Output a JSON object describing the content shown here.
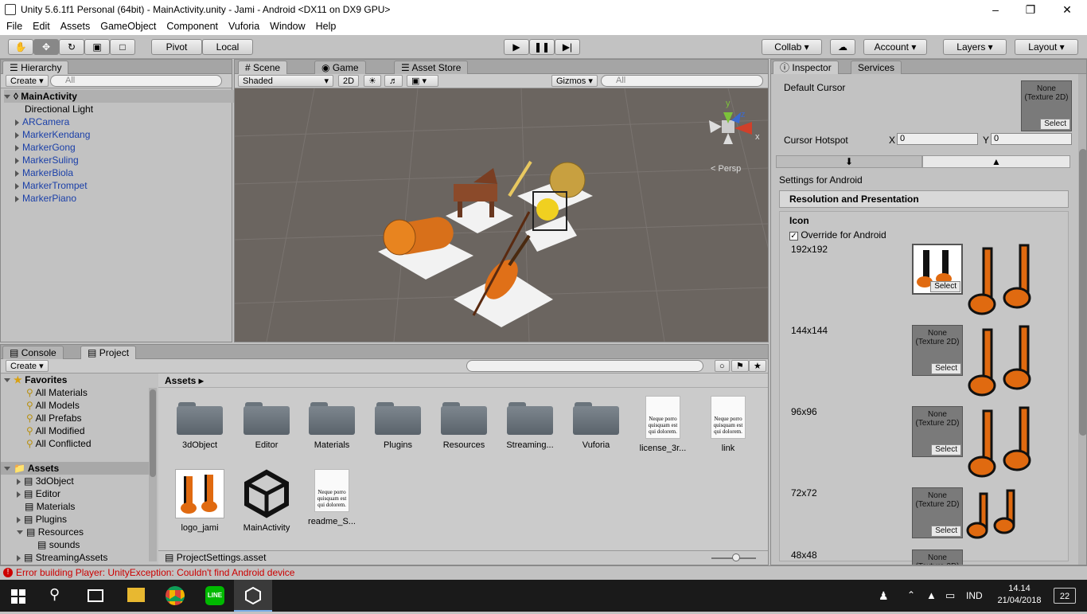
{
  "window": {
    "title": "Unity 5.6.1f1 Personal (64bit) - MainActivity.unity - Jami - Android <DX11 on DX9 GPU>"
  },
  "menu": [
    "File",
    "Edit",
    "Assets",
    "GameObject",
    "Component",
    "Vuforia",
    "Window",
    "Help"
  ],
  "toolbar": {
    "pivot": "Pivot",
    "local": "Local",
    "collab": "Collab ▾",
    "account": "Account",
    "layers": "Layers",
    "layout": "Layout"
  },
  "hierarchy": {
    "tab": "Hierarchy",
    "create": "Create ▾",
    "search_placeholder": "All",
    "scene": "MainActivity",
    "items": [
      "Directional Light",
      "ARCamera",
      "MarkerKendang",
      "MarkerGong",
      "MarkerSuling",
      "MarkerBiola",
      "MarkerTrompet",
      "MarkerPiano"
    ]
  },
  "scene": {
    "tabs": [
      "Scene",
      "Game",
      "Asset Store"
    ],
    "shaded": "Shaded",
    "mode2d": "2D",
    "gizmos": "Gizmos ▾",
    "search_placeholder": "All",
    "persp": "Persp",
    "gizmo_axes": {
      "y": "y",
      "z": "z",
      "x": "x"
    }
  },
  "project": {
    "tabs": [
      "Console",
      "Project"
    ],
    "create": "Create ▾",
    "breadcrumb": "Assets",
    "favorites_label": "Favorites",
    "favorites": [
      "All Materials",
      "All Models",
      "All Prefabs",
      "All Modified",
      "All Conflicted"
    ],
    "assets_label": "Assets",
    "tree": [
      "3dObject",
      "Editor",
      "Materials",
      "Plugins",
      "Resources",
      "sounds",
      "StreamingAssets"
    ],
    "assets": [
      {
        "name": "3dObject",
        "kind": "folder"
      },
      {
        "name": "Editor",
        "kind": "folder"
      },
      {
        "name": "Materials",
        "kind": "folder"
      },
      {
        "name": "Plugins",
        "kind": "folder"
      },
      {
        "name": "Resources",
        "kind": "folder"
      },
      {
        "name": "Streaming...",
        "kind": "folder"
      },
      {
        "name": "Vuforia",
        "kind": "folder"
      },
      {
        "name": "license_3r...",
        "kind": "doc"
      },
      {
        "name": "link",
        "kind": "doc"
      },
      {
        "name": "logo_jami",
        "kind": "image"
      },
      {
        "name": "MainActivity",
        "kind": "unity"
      },
      {
        "name": "readme_S...",
        "kind": "doc"
      }
    ],
    "doc_text": "Neque porro quisquam est qui dolorem.",
    "footer_file": "ProjectSettings.asset"
  },
  "inspector": {
    "tabs": [
      "Inspector",
      "Services"
    ],
    "default_cursor": "Default Cursor",
    "cursor_hotspot": "Cursor Hotspot",
    "hotspot_x_label": "X",
    "hotspot_x": "0",
    "hotspot_y_label": "Y",
    "hotspot_y": "0",
    "settings_for": "Settings for Android",
    "section": "Resolution and Presentation",
    "icon_label": "Icon",
    "override": "Override for Android",
    "none_texture": "None (Texture 2D)",
    "select": "Select",
    "sizes": [
      "192x192",
      "144x144",
      "96x96",
      "72x72",
      "48x48"
    ]
  },
  "status": {
    "error": "Error building Player: UnityException: Couldn't find Android device"
  },
  "taskbar": {
    "time": "14.14",
    "date": "21/04/2018",
    "lang": "IND",
    "notif": "22"
  },
  "colors": {
    "accent_orange": "#e06a10",
    "hierarchy_blue": "#1a3fa8",
    "error_red": "#cc0000"
  }
}
